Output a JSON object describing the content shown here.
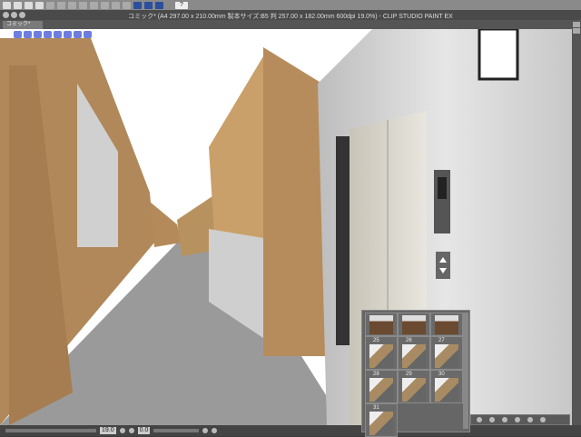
{
  "app": {
    "title": "コミック* (A4 297.00 x 210.00mm 製本サイズ:B5 判 257.00 x 182.00mm 600dpi 19.0%) - CLIP STUDIO PAINT EX"
  },
  "tabs": [
    {
      "label": "コミック*"
    }
  ],
  "toolbar": {
    "help_label": "?"
  },
  "thumbnails": {
    "items": [
      {
        "label": ""
      },
      {
        "label": ""
      },
      {
        "label": ""
      },
      {
        "label": "25"
      },
      {
        "label": "26"
      },
      {
        "label": "27"
      },
      {
        "label": "28"
      },
      {
        "label": "29"
      },
      {
        "label": "30"
      },
      {
        "label": "31"
      }
    ]
  },
  "status": {
    "zoom": "19.0",
    "angle": "0.0"
  }
}
